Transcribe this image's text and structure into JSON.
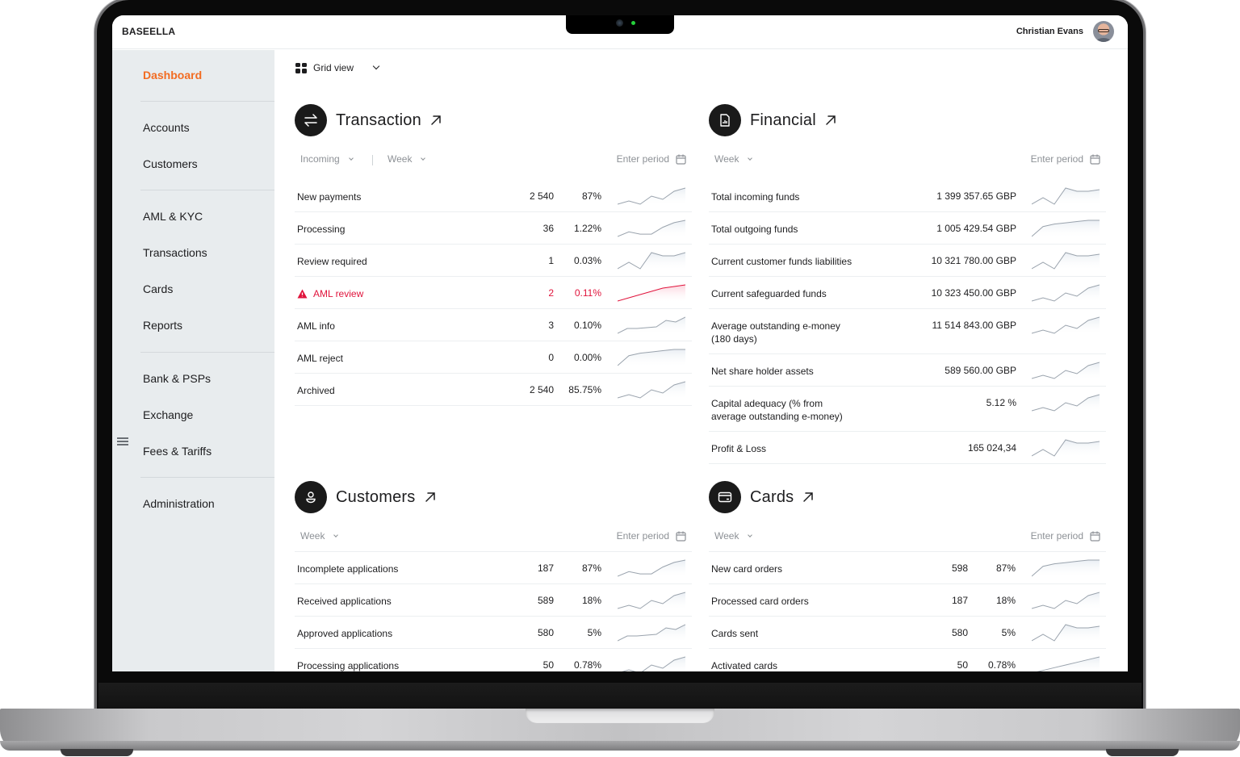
{
  "app": {
    "brand": "BASEELLA",
    "user_name": "Christian Evans"
  },
  "sidebar": {
    "items": [
      {
        "label": "Dashboard",
        "active": true
      },
      {
        "label": "Accounts"
      },
      {
        "label": "Customers"
      },
      {
        "label": "AML & KYC"
      },
      {
        "label": "Transactions"
      },
      {
        "label": "Cards"
      },
      {
        "label": "Reports"
      },
      {
        "label": "Bank & PSPs"
      },
      {
        "label": "Exchange"
      },
      {
        "label": "Fees & Tariffs"
      },
      {
        "label": "Administration"
      }
    ]
  },
  "toolbar": {
    "view_label": "Grid view"
  },
  "colors": {
    "accent": "#f26c22",
    "alert": "#e0143c",
    "spark_line": "#9aa3ad",
    "spark_fill": "#e9eef3"
  },
  "panels": {
    "transaction": {
      "title": "Transaction",
      "icon": "arrows-swap-icon",
      "filters": [
        "Incoming",
        "Week"
      ],
      "period_placeholder": "Enter period",
      "rows": [
        {
          "label": "New payments",
          "count": "2 540",
          "pct": "87%",
          "trend": [
            3,
            5,
            3,
            8,
            6,
            11,
            13
          ]
        },
        {
          "label": "Processing",
          "count": "36",
          "pct": "1.22%",
          "trend": [
            3,
            5,
            4,
            4,
            7,
            9,
            10
          ]
        },
        {
          "label": "Review required",
          "count": "1",
          "pct": "0.03%",
          "trend": [
            3,
            5,
            3,
            8,
            7,
            7,
            8
          ]
        },
        {
          "label": "AML review",
          "count": "2",
          "pct": "0.11%",
          "alert": true,
          "trend": [
            3,
            4,
            5,
            6,
            7,
            7.5,
            8
          ]
        },
        {
          "label": "AML info",
          "count": "3",
          "pct": "0.10%",
          "trend": [
            3,
            6,
            6,
            6.5,
            7,
            11,
            10,
            13
          ]
        },
        {
          "label": "AML reject",
          "count": "0",
          "pct": "0.00%",
          "trend": [
            2,
            6,
            7,
            7.5,
            8,
            8.5,
            8.5
          ]
        },
        {
          "label": "Archived",
          "count": "2 540",
          "pct": "85.75%",
          "trend": [
            3,
            5,
            3,
            8,
            6,
            11,
            13
          ]
        }
      ]
    },
    "financial": {
      "title": "Financial",
      "icon": "document-chart-icon",
      "filters": [
        "Week"
      ],
      "period_placeholder": "Enter period",
      "rows": [
        {
          "label": "Total incoming funds",
          "value": "1 399 357.65 GBP",
          "trend": [
            3,
            5,
            3,
            8,
            7,
            7,
            7.5
          ]
        },
        {
          "label": "Total outgoing funds",
          "value": "1 005 429.54 GBP",
          "trend": [
            2,
            6,
            7,
            7.5,
            8,
            8.5,
            8.5
          ]
        },
        {
          "label": "Current customer funds liabilities",
          "value": "10 321 780.00 GBP",
          "trend": [
            3,
            5,
            3,
            8,
            7,
            7,
            7.5
          ]
        },
        {
          "label": "Current safeguarded funds",
          "value": "10 323 450.00 GBP",
          "trend": [
            3,
            5,
            3,
            8,
            6,
            11,
            13
          ]
        },
        {
          "label": "Average outstanding e-money\n(180 days)",
          "value": "11 514 843.00 GBP",
          "tall": true,
          "trend": [
            3,
            5,
            3,
            8,
            6,
            11,
            13
          ]
        },
        {
          "label": "Net share holder assets",
          "value": "589 560.00 GBP",
          "trend": [
            3,
            5,
            3,
            8,
            6,
            11,
            13
          ]
        },
        {
          "label": "Capital adequacy  (% from\naverage outstanding e-money)",
          "value": "5.12 %",
          "tall": true,
          "trend": [
            3,
            5,
            3,
            8,
            6,
            11,
            13
          ]
        },
        {
          "label": "Profit & Loss",
          "value": "165 024,34",
          "trend": [
            3,
            5,
            3,
            8,
            7,
            7,
            7.5
          ]
        }
      ]
    },
    "customers": {
      "title": "Customers",
      "icon": "user-icon",
      "filters": [
        "Week"
      ],
      "period_placeholder": "Enter period",
      "rows": [
        {
          "label": "Incomplete applications",
          "count": "187",
          "pct": "87%",
          "trend": [
            3,
            5,
            4,
            4,
            7,
            9,
            10
          ]
        },
        {
          "label": "Received applications",
          "count": "589",
          "pct": "18%",
          "trend": [
            3,
            5,
            3,
            8,
            6,
            11,
            13
          ]
        },
        {
          "label": "Approved applications",
          "count": "580",
          "pct": "5%",
          "trend": [
            3,
            6,
            6,
            6.5,
            7,
            11,
            10,
            13
          ]
        },
        {
          "label": "Processing applications",
          "count": "50",
          "pct": "0.78%",
          "trend": [
            3,
            5,
            3,
            8,
            6,
            11,
            13
          ]
        }
      ]
    },
    "cards": {
      "title": "Cards",
      "icon": "credit-card-icon",
      "filters": [
        "Week"
      ],
      "period_placeholder": "Enter period",
      "rows": [
        {
          "label": "New card orders",
          "count": "598",
          "pct": "87%",
          "trend": [
            2,
            6,
            7,
            7.5,
            8,
            8.5,
            8.5
          ]
        },
        {
          "label": "Processed card orders",
          "count": "187",
          "pct": "18%",
          "trend": [
            3,
            5,
            3,
            8,
            6,
            11,
            13
          ]
        },
        {
          "label": "Cards sent",
          "count": "580",
          "pct": "5%",
          "trend": [
            3,
            5,
            3,
            8,
            7,
            7,
            7.5
          ]
        },
        {
          "label": "Activated cards",
          "count": "50",
          "pct": "0.78%",
          "trend": [
            3,
            4,
            5,
            6,
            7,
            8,
            9
          ]
        }
      ]
    }
  }
}
